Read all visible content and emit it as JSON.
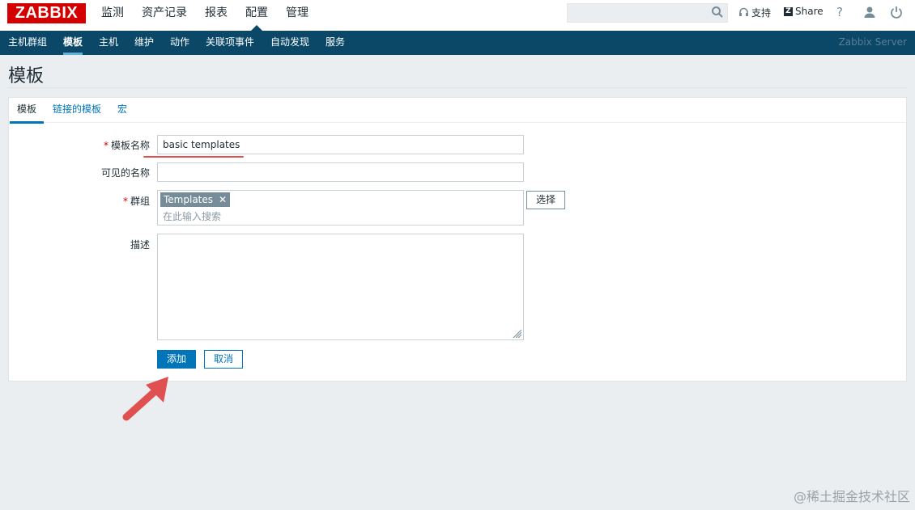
{
  "header": {
    "logo": "ZABBIX",
    "menu": [
      "监测",
      "资产记录",
      "报表",
      "配置",
      "管理"
    ],
    "active_menu": "配置",
    "search_placeholder": "",
    "support_label": "支持",
    "share_label": "Share",
    "help_label": "?"
  },
  "subnav": {
    "items": [
      "主机群组",
      "模板",
      "主机",
      "维护",
      "动作",
      "关联项事件",
      "自动发现",
      "服务"
    ],
    "active": "模板",
    "server_name": "Zabbix Server"
  },
  "page": {
    "title": "模板"
  },
  "tabs": [
    "模板",
    "链接的模板",
    "宏"
  ],
  "form": {
    "template_name_label": "模板名称",
    "template_name_value": "basic templates",
    "visible_name_label": "可见的名称",
    "visible_name_value": "",
    "groups_label": "群组",
    "group_chip": "Templates",
    "group_chip_remove": "✕",
    "groups_placeholder": "在此输入搜索",
    "select_button": "选择",
    "description_label": "描述",
    "description_value": "",
    "add_button": "添加",
    "cancel_button": "取消",
    "required_marker": "*"
  },
  "watermark": "@稀土掘金技术社区",
  "colors": {
    "brand_red": "#d40000",
    "nav_blue": "#0b4868",
    "accent_blue": "#0275b8",
    "chip_gray": "#768d99",
    "annotation_red": "#e05050"
  },
  "icons": {
    "search": "search-icon",
    "support": "headset-icon",
    "share": "z-share-icon",
    "help": "help-icon",
    "user": "user-icon",
    "power": "power-icon"
  }
}
